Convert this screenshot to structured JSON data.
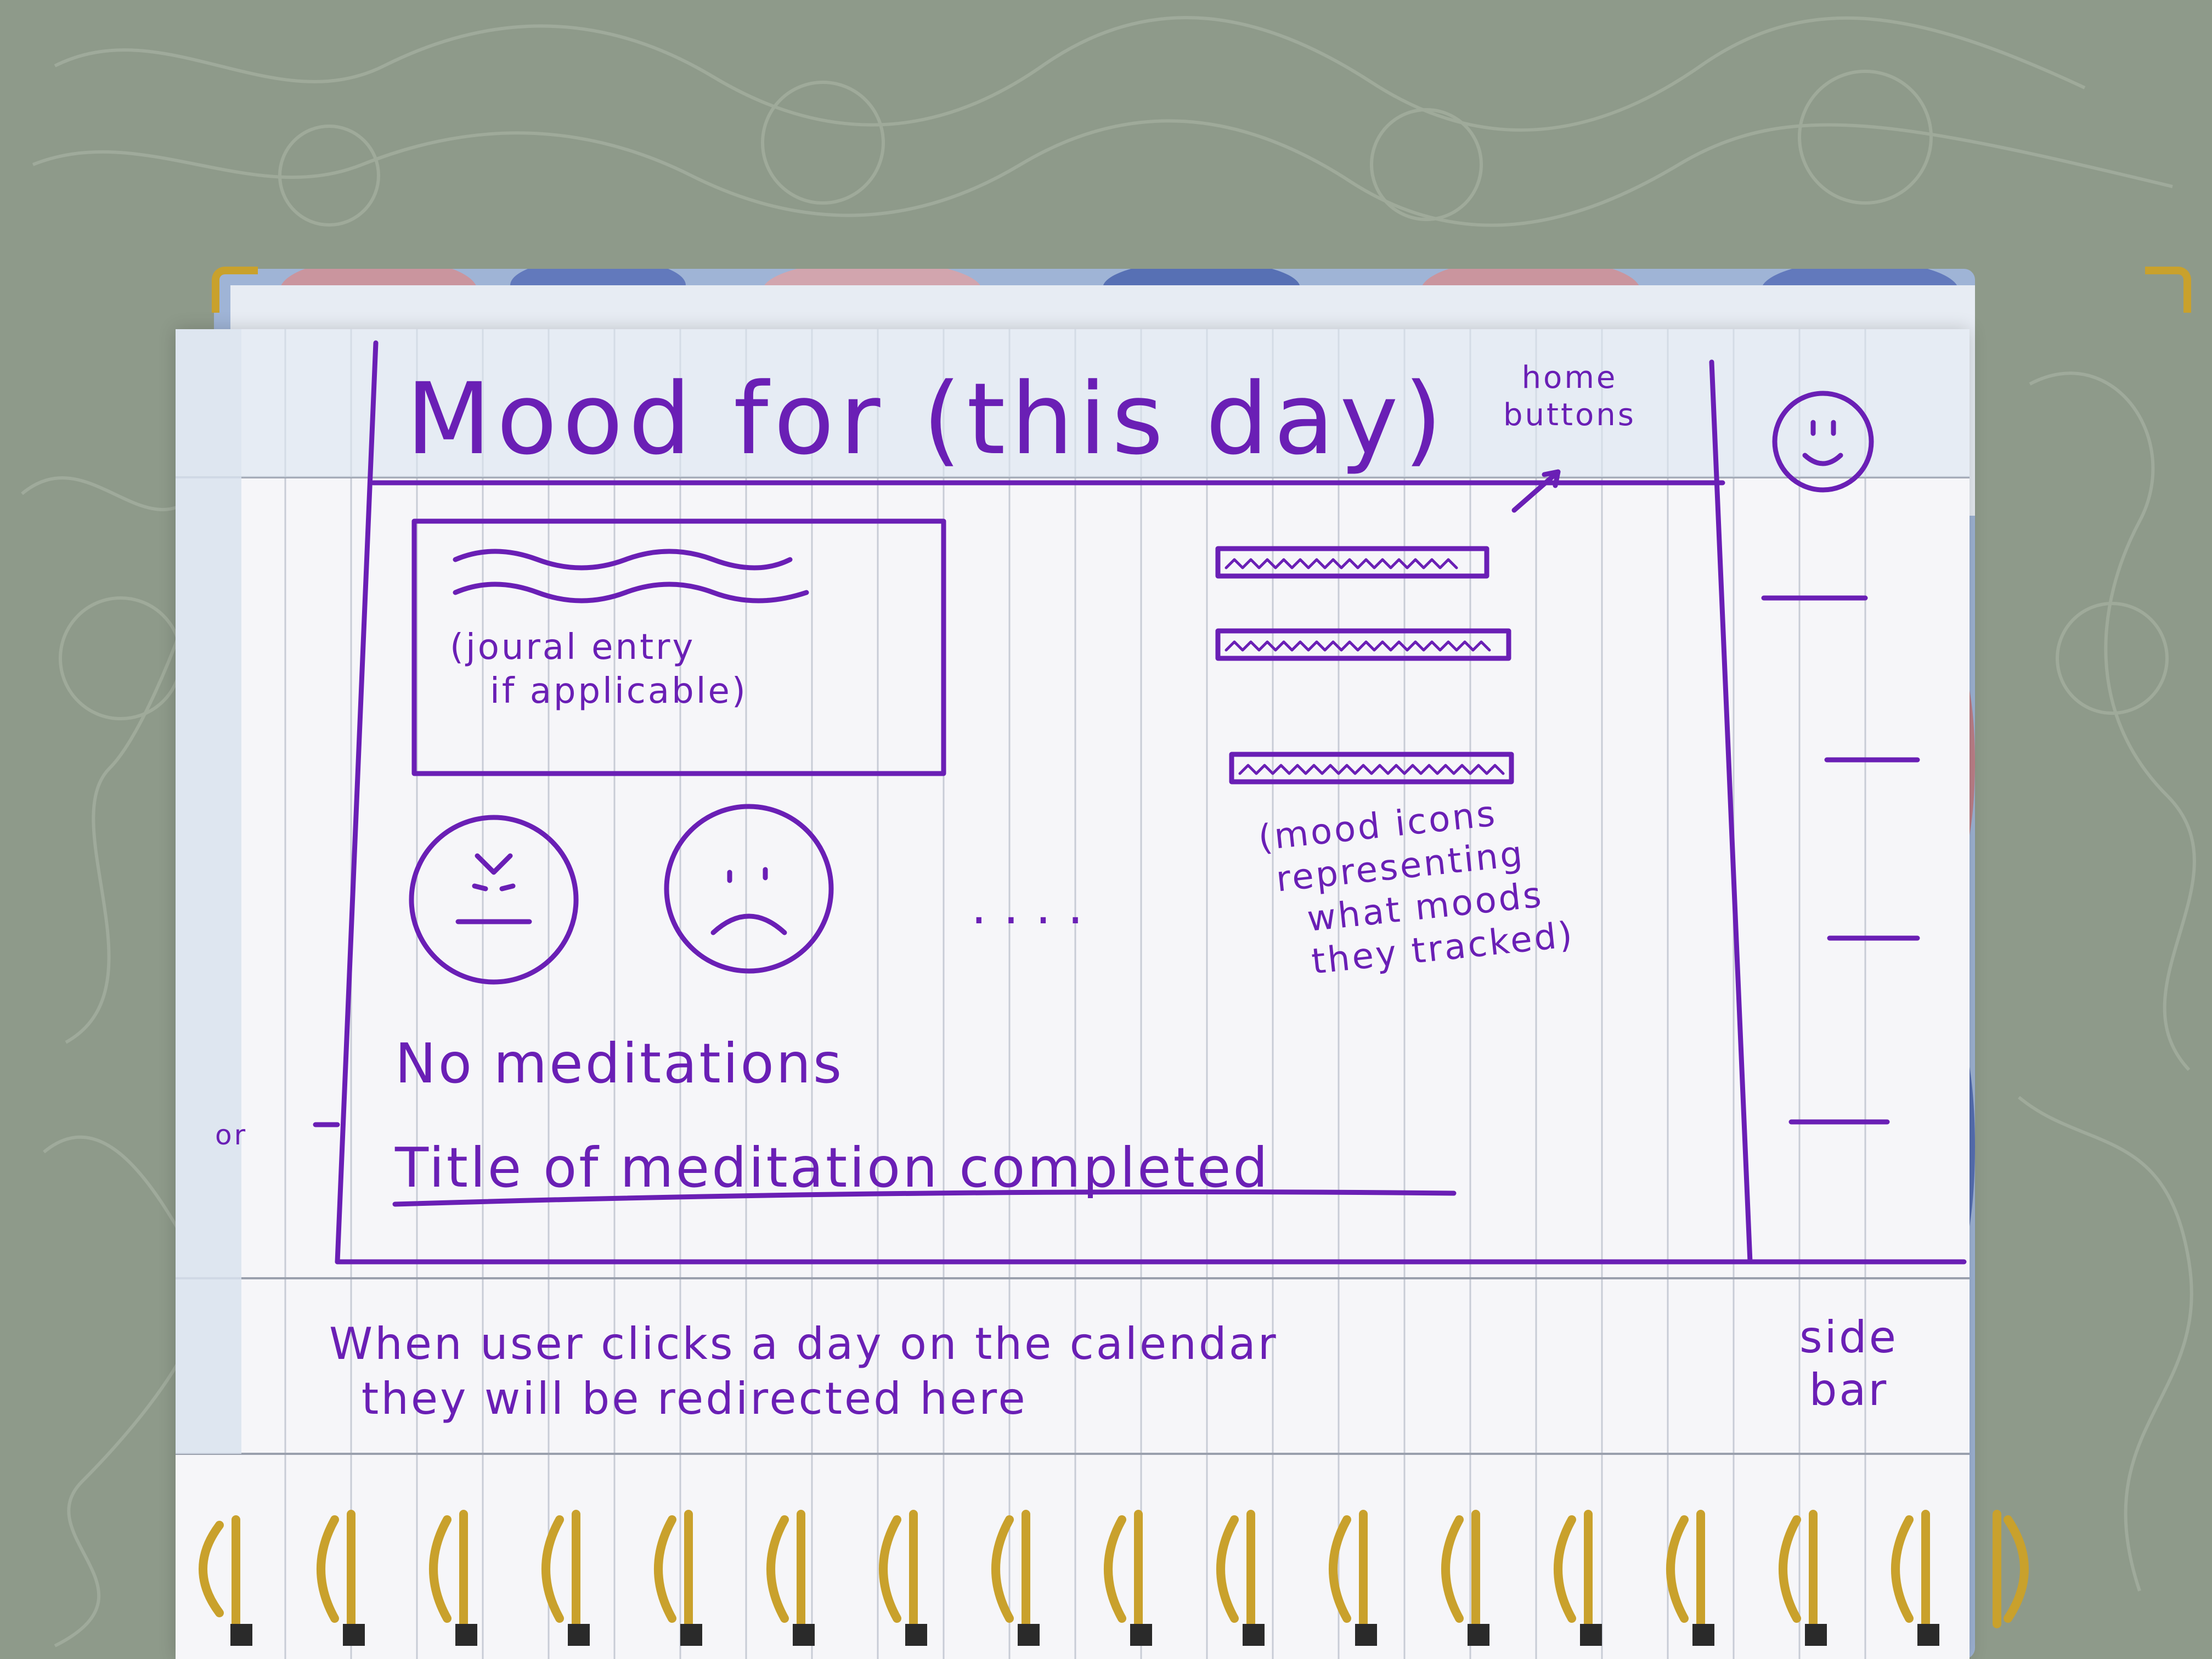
{
  "sketch": {
    "title": "Mood for (this day)",
    "home_buttons_label": "home\nbuttons",
    "journal_label": "(joural entry\n   if applicable)",
    "mood_icons_note": "(mood icons\n representing\n   what moods\n   they tracked)",
    "ellipsis": "....",
    "no_meditations": "No meditations",
    "or_label": "or",
    "meditation_title": "Title of meditation completed",
    "footer_note": "When user clicks a day on the calendar\n  they will be redirected here",
    "sidebar_label": "side\nbar",
    "ink_color": "#6a1fb5",
    "mood_icons": [
      "annoyed-face-icon",
      "sad-face-icon"
    ],
    "home_icon": "smiley-face-icon"
  }
}
